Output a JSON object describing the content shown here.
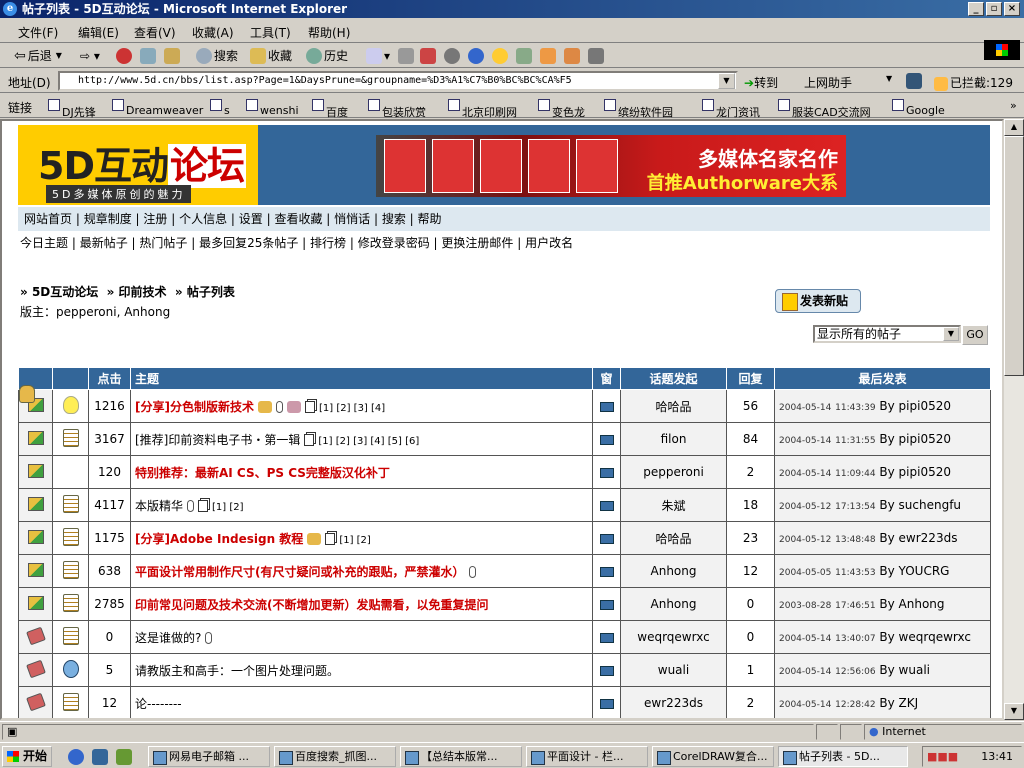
{
  "window": {
    "title": "帖子列表 - 5D互动论坛 - Microsoft Internet Explorer"
  },
  "menu": [
    "文件(F)",
    "编辑(E)",
    "查看(V)",
    "收藏(A)",
    "工具(T)",
    "帮助(H)"
  ],
  "toolbar": {
    "back": "后退",
    "search": "搜索",
    "favorites": "收藏",
    "history": "历史"
  },
  "address": {
    "label": "地址(D)",
    "url": "http://www.5d.cn/bbs/list.asp?Page=1&DaysPrune=&groupname=%D3%A1%C7%B0%BC%BC%CA%F5",
    "go": "转到",
    "helper": "上网助手",
    "blocked": "已拦截:129"
  },
  "links": {
    "label": "链接",
    "items": [
      "DJ先锋",
      "Dreamweaver",
      "s",
      "wenshi",
      "百度",
      "包装欣赏",
      "北京印刷网",
      "变色龙",
      "缤纷软件园",
      "龙门资讯",
      "服装CAD交流网",
      "Google"
    ]
  },
  "banner": {
    "logo_text": "5D互动",
    "logo_highlight": "论坛",
    "slogan": "5D多媒体原创的魅力",
    "ad_line1": "多媒体名家名作",
    "ad_line2": "首推Authorware大系"
  },
  "nav_main": [
    "网站首页",
    "规章制度",
    "注册",
    "个人信息",
    "设置",
    "查看收藏",
    "悄悄话",
    "搜索",
    "帮助"
  ],
  "nav_sub": [
    "今日主题",
    "最新帖子",
    "热门帖子",
    "最多回复25条帖子",
    "排行榜",
    "修改登录密码",
    "更换注册邮件",
    "用户改名"
  ],
  "breadcrumb": [
    "5D互动论坛",
    "印前技术",
    "帖子列表"
  ],
  "moderators": "版主：pepperoni, Anhong",
  "new_post": "发表新贴",
  "filter": {
    "selected": "显示所有的帖子",
    "go": "GO"
  },
  "table": {
    "headers": [
      "点击",
      "主题",
      "窗",
      "话题发起",
      "回复",
      "最后发表"
    ],
    "rows": [
      {
        "folder": "hot",
        "mood": "bulb",
        "clicks": "1216",
        "title": "[分享]分色制版新技术",
        "red": true,
        "extras": "hand attach tool multi",
        "pages": "[1] [2] [3] [4]",
        "author": "哈哈品",
        "replies": "56",
        "date": "2004-05-14",
        "time": "11:43:39",
        "by": "By pipi0520"
      },
      {
        "folder": "hot",
        "mood": "note",
        "clicks": "3167",
        "title": "[推荐]印前资料电子书・第一辑",
        "red": false,
        "extras": "multi",
        "pages": "[1] [2] [3] [4] [5] [6]",
        "author": "filon",
        "replies": "84",
        "date": "2004-05-14",
        "time": "11:31:55",
        "by": "By pipi0520"
      },
      {
        "folder": "hot",
        "mood": "thumb",
        "clicks": "120",
        "title": "特别推荐：最新AI CS、PS CS完整版汉化补丁",
        "red": true,
        "extras": "",
        "pages": "",
        "author": "pepperoni",
        "replies": "2",
        "date": "2004-05-14",
        "time": "11:09:44",
        "by": "By pipi0520"
      },
      {
        "folder": "hot",
        "mood": "note",
        "clicks": "4117",
        "title": "本版精华",
        "red": false,
        "extras": "attach multi",
        "pages": "[1] [2]",
        "author": "朱斌",
        "replies": "18",
        "date": "2004-05-12",
        "time": "17:13:54",
        "by": "By suchengfu"
      },
      {
        "folder": "hot",
        "mood": "note",
        "clicks": "1175",
        "title": "[分享]Adobe Indesign 教程",
        "red": true,
        "extras": "hand multi",
        "pages": "[1] [2]",
        "author": "哈哈品",
        "replies": "23",
        "date": "2004-05-12",
        "time": "13:48:48",
        "by": "By ewr223ds"
      },
      {
        "folder": "hot",
        "mood": "note",
        "clicks": "638",
        "title": "平面设计常用制作尺寸(有尺寸疑问或补充的跟贴，严禁灌水）",
        "red": true,
        "extras": "attach",
        "pages": "",
        "author": "Anhong",
        "replies": "12",
        "date": "2004-05-05",
        "time": "11:43:53",
        "by": "By YOUCRG"
      },
      {
        "folder": "hot",
        "mood": "note",
        "clicks": "2785",
        "title": "印前常见问题及技术交流(不断增加更新）发贴需看，以免重复提问",
        "red": true,
        "extras": "",
        "pages": "",
        "author": "Anhong",
        "replies": "0",
        "date": "2003-08-28",
        "time": "17:46:51",
        "by": "By Anhong"
      },
      {
        "folder": "lock",
        "mood": "note",
        "clicks": "0",
        "title": "这是谁做的?",
        "red": false,
        "extras": "attach",
        "pages": "",
        "author": "weqrqewrxc",
        "replies": "0",
        "date": "2004-05-14",
        "time": "13:40:07",
        "by": "By weqrqewrxc"
      },
      {
        "folder": "lock",
        "mood": "robot",
        "clicks": "5",
        "title": "请教版主和高手：一个图片处理问题。",
        "red": false,
        "extras": "",
        "pages": "",
        "author": "wuali",
        "replies": "1",
        "date": "2004-05-14",
        "time": "12:56:06",
        "by": "By wuali"
      },
      {
        "folder": "lock",
        "mood": "note",
        "clicks": "12",
        "title": "论--------",
        "red": false,
        "extras": "",
        "pages": "",
        "author": "ewr223ds",
        "replies": "2",
        "date": "2004-05-14",
        "time": "12:28:42",
        "by": "By ZKJ"
      }
    ]
  },
  "status": {
    "zone": "Internet"
  },
  "taskbar": {
    "start": "开始",
    "tasks": [
      "网易电子邮箱 ...",
      "百度搜索_抓图...",
      "【总结本版常...",
      "平面设计 - 栏...",
      "CorelDRAW复合...",
      "帖子列表 - 5D..."
    ],
    "clock": "13:41"
  }
}
